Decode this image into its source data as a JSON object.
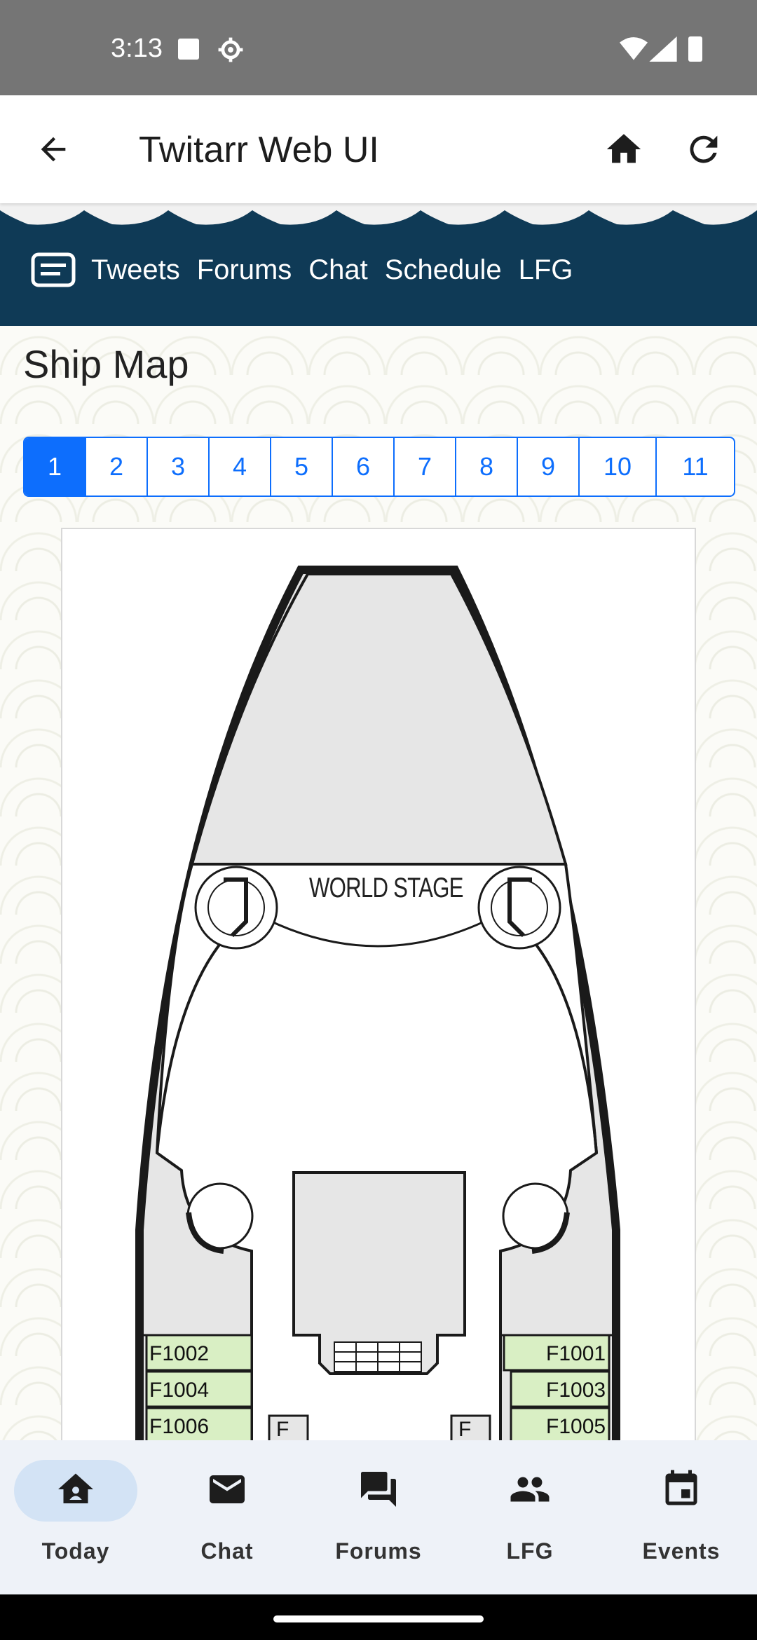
{
  "status": {
    "time": "3:13"
  },
  "appbar": {
    "title": "Twitarr Web UI"
  },
  "nav": {
    "items": [
      "Tweets",
      "Forums",
      "Chat",
      "Schedule",
      "LFG"
    ]
  },
  "page": {
    "title": "Ship Map"
  },
  "pager": {
    "pages": [
      "1",
      "2",
      "3",
      "4",
      "5",
      "6",
      "7",
      "8",
      "9",
      "10",
      "11"
    ],
    "selected": "1"
  },
  "map": {
    "venue_label": "WORLD STAGE",
    "cabins_left": [
      "F1002",
      "F1004",
      "F1006"
    ],
    "cabins_right": [
      "F1001",
      "F1003",
      "F1005"
    ],
    "small_labels": [
      "F",
      "F"
    ]
  },
  "bottom_nav": {
    "tabs": [
      {
        "label": "Today",
        "icon": "home-icon"
      },
      {
        "label": "Chat",
        "icon": "mail-icon"
      },
      {
        "label": "Forums",
        "icon": "forum-icon"
      },
      {
        "label": "LFG",
        "icon": "people-icon"
      },
      {
        "label": "Events",
        "icon": "calendar-icon"
      }
    ]
  },
  "colors": {
    "brand_navy": "#0f3a56",
    "accent_blue": "#0d6efd",
    "cabin_green": "#d9efc4"
  }
}
